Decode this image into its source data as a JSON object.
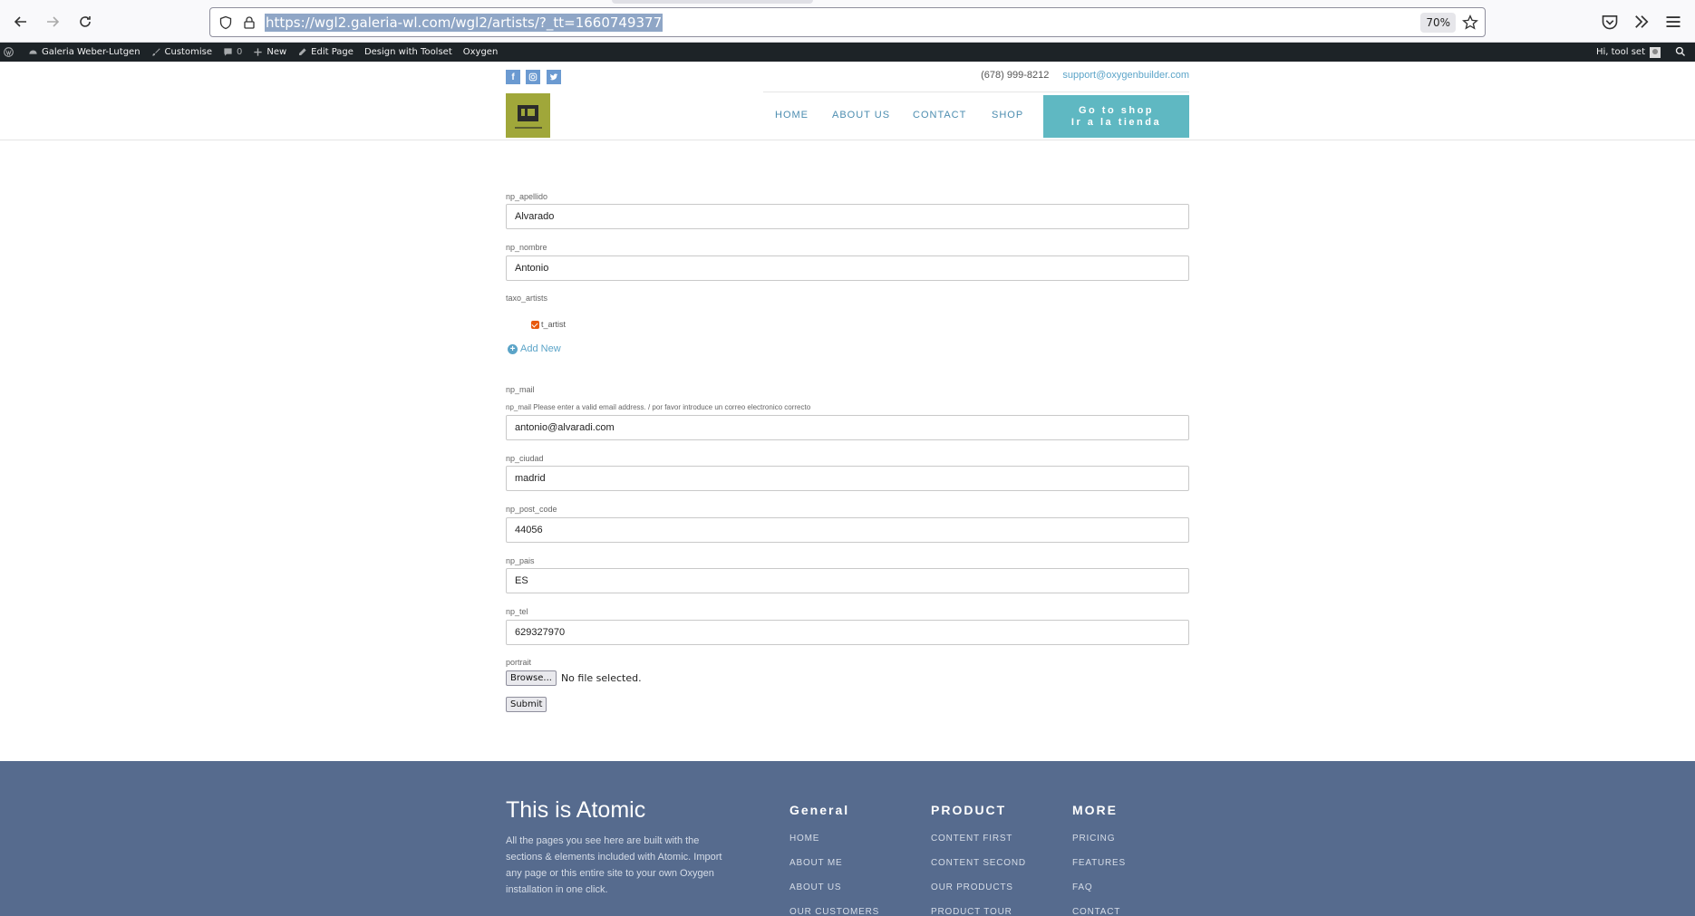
{
  "browser": {
    "url": "https://wgl2.galeria-wl.com/wgl2/artists/?_tt=1660749377",
    "zoom": "70%",
    "icons": [
      "back-icon",
      "forward-icon",
      "reload-icon",
      "shield-icon",
      "lock-icon",
      "bookmark-star-icon",
      "pocket-icon",
      "extensions-overflow-icon",
      "menu-icon"
    ]
  },
  "admin_bar": {
    "site_name": "Galeria Weber-Lutgen",
    "customise": "Customise",
    "comments_count": "0",
    "new": "New",
    "edit_page": "Edit Page",
    "design_toolset": "Design with Toolset",
    "oxygen": "Oxygen",
    "greeting": "Hi, tool set"
  },
  "header": {
    "social": [
      "f",
      "ig",
      "tw"
    ],
    "phone": "(678) 999-8212",
    "email": "support@oxygenbuilder.com",
    "nav": {
      "home": "HOME",
      "about": "ABOUT US",
      "contact": "CONTACT",
      "shop": "SHOP"
    },
    "cta_line1": "Go to shop",
    "cta_line2": "Ir a la tienda",
    "cta_color": "#5fb8c2"
  },
  "form": {
    "apellido_label": "np_apellido",
    "apellido_value": "Alvarado",
    "nombre_label": "np_nombre",
    "nombre_value": "Antonio",
    "taxo_label": "taxo_artists",
    "taxo_option": "t_artist",
    "taxo_checked": true,
    "add_new": "Add New",
    "mail_label": "np_mail",
    "mail_hint": "np_mail Please enter a valid email address. / por favor introduce un correo electronico correcto",
    "mail_value": "antonio@alvaradi.com",
    "ciudad_label": "np_ciudad",
    "ciudad_value": "madrid",
    "post_code_label": "np_post_code",
    "post_code_value": "44056",
    "pais_label": "np_pais",
    "pais_value": "ES",
    "tel_label": "np_tel",
    "tel_value": "629327970",
    "portrait_label": "portrait",
    "browse": "Browse...",
    "file_status": "No file selected.",
    "submit": "Submit"
  },
  "footer": {
    "title": "This is Atomic",
    "text": "All the pages you see here are built with the sections & elements included with Atomic. Import any page or this entire site to your own Oxygen installation in one click.",
    "col1": {
      "head": "General",
      "links": [
        "HOME",
        "ABOUT ME",
        "ABOUT US",
        "OUR CUSTOMERS"
      ]
    },
    "col2": {
      "head": "PRODUCT",
      "links": [
        "CONTENT FIRST",
        "CONTENT SECOND",
        "OUR PRODUCTS",
        "PRODUCT TOUR"
      ]
    },
    "col3": {
      "head": "MORE",
      "links": [
        "PRICING",
        "FEATURES",
        "FAQ",
        "CONTACT"
      ]
    },
    "bg_color": "#566b8e"
  }
}
